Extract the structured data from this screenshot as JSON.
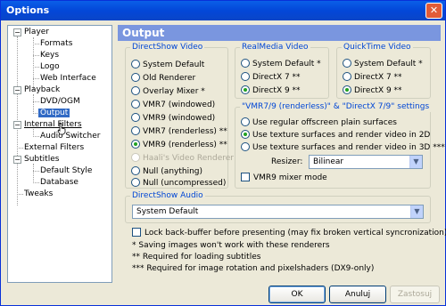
{
  "window": {
    "title": "Options",
    "close_glyph": "✕"
  },
  "tree": {
    "items": [
      {
        "label": "Player"
      },
      {
        "label": "Formats"
      },
      {
        "label": "Keys"
      },
      {
        "label": "Logo"
      },
      {
        "label": "Web Interface"
      },
      {
        "label": "Playback"
      },
      {
        "label": "DVD/OGM"
      },
      {
        "label": "Output",
        "selected": true
      },
      {
        "label": "Internal Filters"
      },
      {
        "label": "Audio Switcher"
      },
      {
        "label": "External Filters"
      },
      {
        "label": "Subtitles"
      },
      {
        "label": "Default Style"
      },
      {
        "label": "Database"
      },
      {
        "label": "Tweaks"
      }
    ],
    "collapse_glyph": "−"
  },
  "page": {
    "title": "Output"
  },
  "directshow_video": {
    "title": "DirectShow Video",
    "options": [
      {
        "label": "System Default",
        "checked": false,
        "disabled": false
      },
      {
        "label": "Old Renderer",
        "checked": false,
        "disabled": false
      },
      {
        "label": "Overlay Mixer *",
        "checked": false,
        "disabled": false
      },
      {
        "label": "VMR7 (windowed)",
        "checked": false,
        "disabled": false
      },
      {
        "label": "VMR9 (windowed)",
        "checked": false,
        "disabled": false
      },
      {
        "label": "VMR7 (renderless) **",
        "checked": false,
        "disabled": false
      },
      {
        "label": "VMR9 (renderless) **",
        "checked": true,
        "disabled": false
      },
      {
        "label": "Haali's Video Renderer",
        "checked": false,
        "disabled": true
      },
      {
        "label": "Null (anything)",
        "checked": false,
        "disabled": false
      },
      {
        "label": "Null (uncompressed)",
        "checked": false,
        "disabled": false
      }
    ]
  },
  "realmedia_video": {
    "title": "RealMedia Video",
    "options": [
      {
        "label": "System Default *",
        "checked": false
      },
      {
        "label": "DirectX 7 **",
        "checked": false
      },
      {
        "label": "DirectX 9 **",
        "checked": true
      }
    ]
  },
  "quicktime_video": {
    "title": "QuickTime Video",
    "options": [
      {
        "label": "System Default *",
        "checked": false
      },
      {
        "label": "DirectX 7 **",
        "checked": false
      },
      {
        "label": "DirectX 9 **",
        "checked": true
      }
    ]
  },
  "vmr_settings": {
    "title": "\"VMR7/9 (renderless)\" & \"DirectX 7/9\" settings",
    "options": [
      {
        "label": "Use regular offscreen plain surfaces",
        "checked": false
      },
      {
        "label": "Use texture surfaces and render video in 2D",
        "checked": true
      },
      {
        "label": "Use texture surfaces and render video in 3D ***",
        "checked": false
      }
    ],
    "resizer_label": "Resizer:",
    "resizer_value": "Bilinear",
    "mixer_label": "VMR9 mixer mode",
    "mixer_checked": false
  },
  "directshow_audio": {
    "title": "DirectShow Audio",
    "value": "System Default"
  },
  "lock_backbuffer": {
    "label": "Lock back-buffer before presenting (may fix broken vertical syncronization)",
    "checked": false
  },
  "notes": [
    "* Saving images won't work with these renderers",
    "** Required for loading subtitles",
    "*** Required for image rotation and pixelshaders (DX9-only)"
  ],
  "buttons": {
    "ok": "OK",
    "cancel": "Anuluj",
    "apply": "Zastosuj"
  },
  "combo_arrow_glyph": "▼",
  "colors": {
    "header": "#7a96df",
    "selected": "#316ac5",
    "group_title": "#0046d5"
  }
}
